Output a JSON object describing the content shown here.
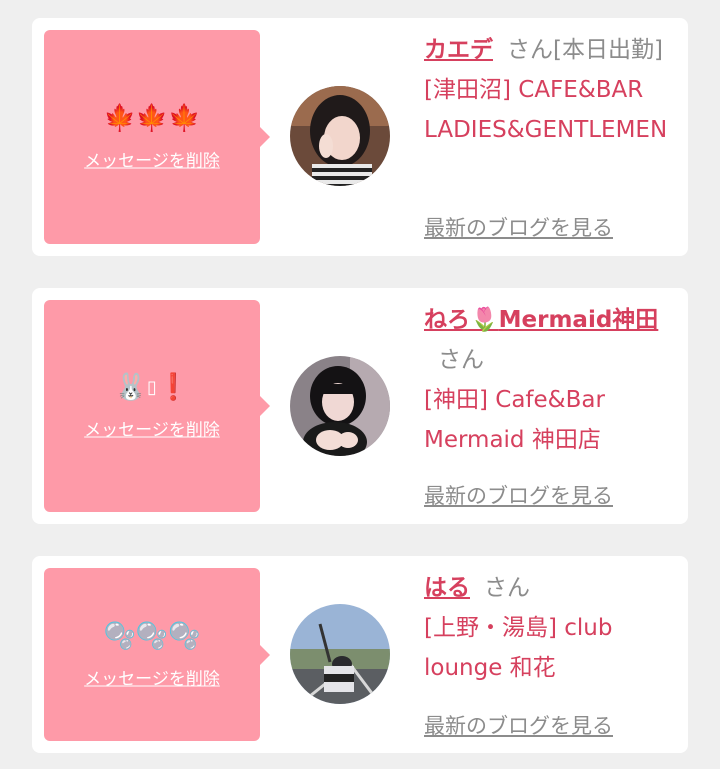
{
  "cards": [
    {
      "status_emoji": "🍁🍁🍁",
      "delete_label": "メッセージを削除",
      "name": "カエデ",
      "honorific": "さん",
      "status_tag": "[本日出勤]",
      "shop": "[津田沼] CAFE&BAR LADIES&GENTLEMEN",
      "blog_label": "最新のブログを見る",
      "avatar_icon": "profile-photo"
    },
    {
      "status_emoji": "🐰▯❗",
      "delete_label": "メッセージを削除",
      "name_prefix": "ねろ",
      "name_emoji": "🌷",
      "name_suffix": "Mermaid神田",
      "honorific": "さん",
      "shop": "[神田] Cafe&Bar Mermaid 神田店",
      "blog_label": "最新のブログを見る",
      "avatar_icon": "profile-photo"
    },
    {
      "status_emoji": "🫧🫧🫧",
      "delete_label": "メッセージを削除",
      "name": "はる",
      "honorific": "さん",
      "shop": "[上野・湯島] club lounge 和花",
      "blog_label": "最新のブログを見る",
      "avatar_icon": "profile-photo"
    }
  ],
  "colors": {
    "background": "#efefef",
    "card": "#ffffff",
    "bubble": "#fe9aa8",
    "accent": "#d6405e",
    "muted": "#8c8c8c"
  }
}
